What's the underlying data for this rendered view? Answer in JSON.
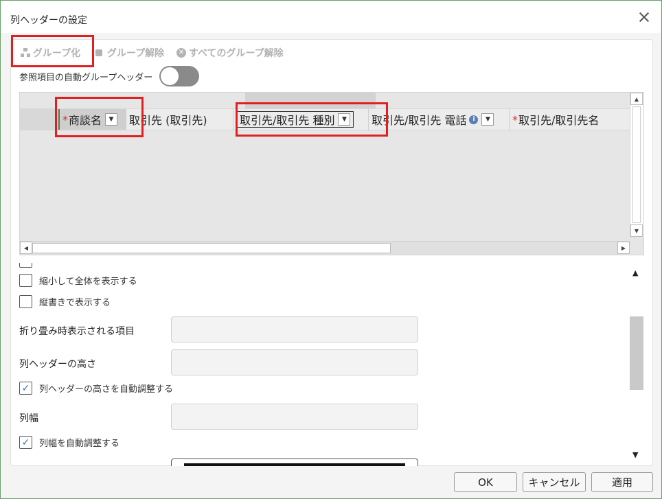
{
  "dialog": {
    "title": "列ヘッダーの設定"
  },
  "toolbar": {
    "group_label": "グループ化",
    "ungroup_label": "グループ解除",
    "ungroup_all_label": "すべてのグループ解除",
    "ungroup_all_icon_glyph": "✕"
  },
  "auto_group_header": {
    "label": "参照項目の自動グループヘッダー",
    "enabled": false
  },
  "grid": {
    "columns": [
      {
        "label": "商談名",
        "required": true,
        "required_mark": "*",
        "dropdown_glyph": "▼"
      },
      {
        "label": "取引先 (取引先)",
        "required": false
      },
      {
        "label": "取引先/取引先 種別",
        "required": false,
        "dropdown_glyph": "▼"
      },
      {
        "label": "取引先/取引先 電話",
        "required": false,
        "info_glyph": "i",
        "dropdown_glyph": "▼"
      },
      {
        "label": "取引先/取引先名",
        "required": true,
        "required_mark": "*"
      }
    ],
    "scroll_glyphs": {
      "up": "▲",
      "down": "▼",
      "left": "◀",
      "right": "▶"
    }
  },
  "options": {
    "shrink_to_fit": {
      "label": "縮小して全体を表示する",
      "checked": false
    },
    "vertical_text": {
      "label": "縦書きで表示する",
      "checked": false
    },
    "collapsed_items_label": "折り畳み時表示される項目",
    "header_height_label": "列ヘッダーの高さ",
    "auto_header_height": {
      "label": "列ヘッダーの高さを自動調整する",
      "checked": true
    },
    "column_width_label": "列幅",
    "auto_column_width": {
      "label": "列幅を自動調整する",
      "checked": true
    },
    "check_glyph": "✓",
    "scroll_glyphs": {
      "up": "▲",
      "down": "▼"
    }
  },
  "footer": {
    "ok": "OK",
    "cancel": "キャンセル",
    "apply": "適用"
  },
  "colors": {
    "highlight": "#e02020",
    "required": "#d32f2f",
    "check": "#2f6fc6",
    "toggle_off": "#8a8a8a"
  }
}
